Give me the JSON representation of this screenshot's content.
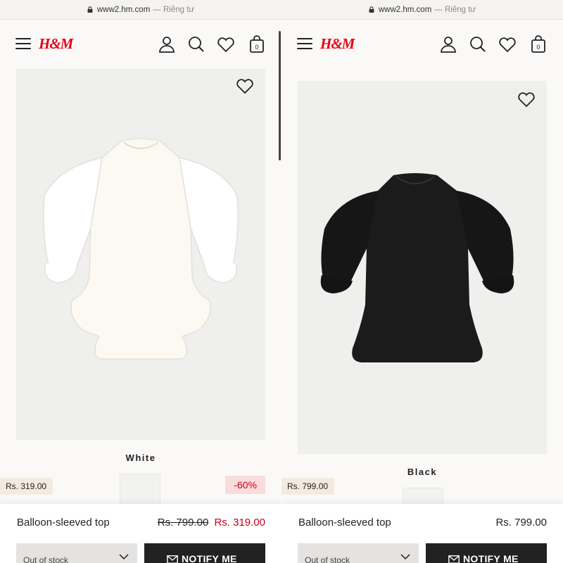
{
  "browser": {
    "url": "www2.hm.com",
    "separator": "—",
    "mode": "Riêng tư"
  },
  "brand": {
    "logo": "H&M",
    "logo_color": "#e50010"
  },
  "header_icons": [
    "menu-icon",
    "account-icon",
    "search-icon",
    "favorites-icon",
    "bag-icon"
  ],
  "bag_count": "0",
  "left_product": {
    "color_name": "White",
    "thumb_price": "Rs. 319.00",
    "discount": "-60%",
    "name": "Balloon-sleeved top",
    "old_price": "Rs. 799.00",
    "new_price": "Rs. 319.00",
    "stock_status": "Out of stock",
    "notify_label": "NOTIFY ME"
  },
  "right_product": {
    "color_name": "Black",
    "thumb_price": "Rs. 799.00",
    "name": "Balloon-sleeved top",
    "price": "Rs. 799.00",
    "stock_status": "Out of stock",
    "notify_label": "NOTIFY ME"
  },
  "colors": {
    "sale_red": "#c4001a",
    "bg": "#faf9f8",
    "photo_bg": "#efefed",
    "button_dark": "#222222"
  }
}
